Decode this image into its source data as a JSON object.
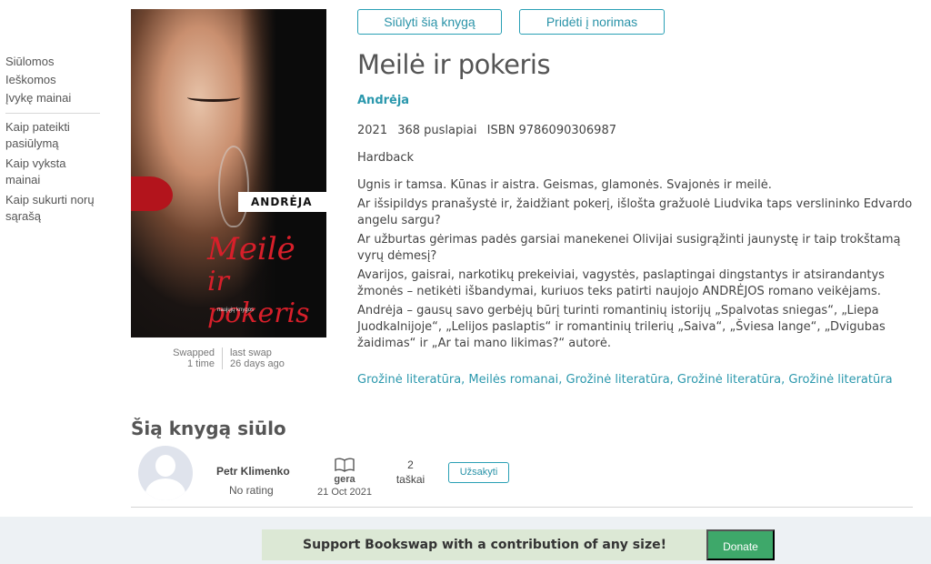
{
  "sidebar": {
    "items": [
      {
        "label": "Siūlomos"
      },
      {
        "label": "Ieškomos"
      },
      {
        "label": "Įvykę mainai"
      }
    ],
    "help": [
      {
        "label": "Kaip pateikti pasiūlymą"
      },
      {
        "label": "Kaip vyksta mainai"
      },
      {
        "label": "Kaip sukurti norų sąrašą"
      }
    ]
  },
  "actions": {
    "suggest_label": "Siūlyti šią knygą",
    "wishlist_label": "Pridėti į norimas"
  },
  "cover": {
    "author_band": "ANDRĖJA",
    "title_line1": "Meilė",
    "title_line2": "ir pokeris",
    "publisher": "naujųjų knygos"
  },
  "swap_stats": {
    "swapped_label": "Swapped",
    "swapped_value": "1 time",
    "last_swap_label": "last swap",
    "last_swap_value": "26 days ago"
  },
  "book": {
    "title": "Meilė ir pokeris",
    "author": "Andrėja",
    "year": "2021",
    "pages": "368 puslapiai",
    "isbn": "ISBN 9786090306987",
    "binding": "Hardback",
    "description": [
      "Ugnis ir tamsa. Kūnas ir aistra. Geismas, glamonės. Svajonės ir meilė.",
      "Ar išsipildys pranašystė ir, žaidžiant pokerį, išlošta gražuolė Liudvika taps verslininko Edvardo angelu sargu?",
      "Ar užburtas gėrimas padės garsiai manekenei Olivijai susigrąžinti jaunystę ir taip trokštamą vyrų dėmesį?",
      "Avarijos, gaisrai, narkotikų prekeiviai, vagystės, paslaptingai dingstantys ir atsirandantys žmonės – netikėti išbandymai, kuriuos teks patirti naujojo ANDRĖJOS romano veikėjams.",
      "Andrėja – gausų savo gerbėjų būrį turinti romantinių istorijų „Spalvotas sniegas“, „Liepa Juodkalnijoje“, „Lelijos paslaptis“ ir romantinių trilerių „Saiva“, „Šviesa lange“, „Dvigubas žaidimas“ ir „Ar tai mano likimas?“ autorė."
    ],
    "genres": "Grožinė literatūra, Meilės romanai, Grožinė literatūra, Grožinė literatūra, Grožinė literatūra"
  },
  "offers": {
    "section_title": "Šią knygą siūlo",
    "rows": [
      {
        "user_name": "Petr Klimenko",
        "user_rating": "No rating",
        "condition": "gera",
        "date": "21 Oct 2021",
        "points_value": "2",
        "points_label": "taškai",
        "order_label": "Užsakyti"
      }
    ]
  },
  "footer": {
    "support_text": "Support  Bookswap with a contribution of any size!",
    "donate_label": "Donate"
  },
  "colors": {
    "accent": "#2aa0b5",
    "donate": "#3ea86a",
    "support_bg": "#dce8d5",
    "footer_bg": "#edf1f4"
  }
}
